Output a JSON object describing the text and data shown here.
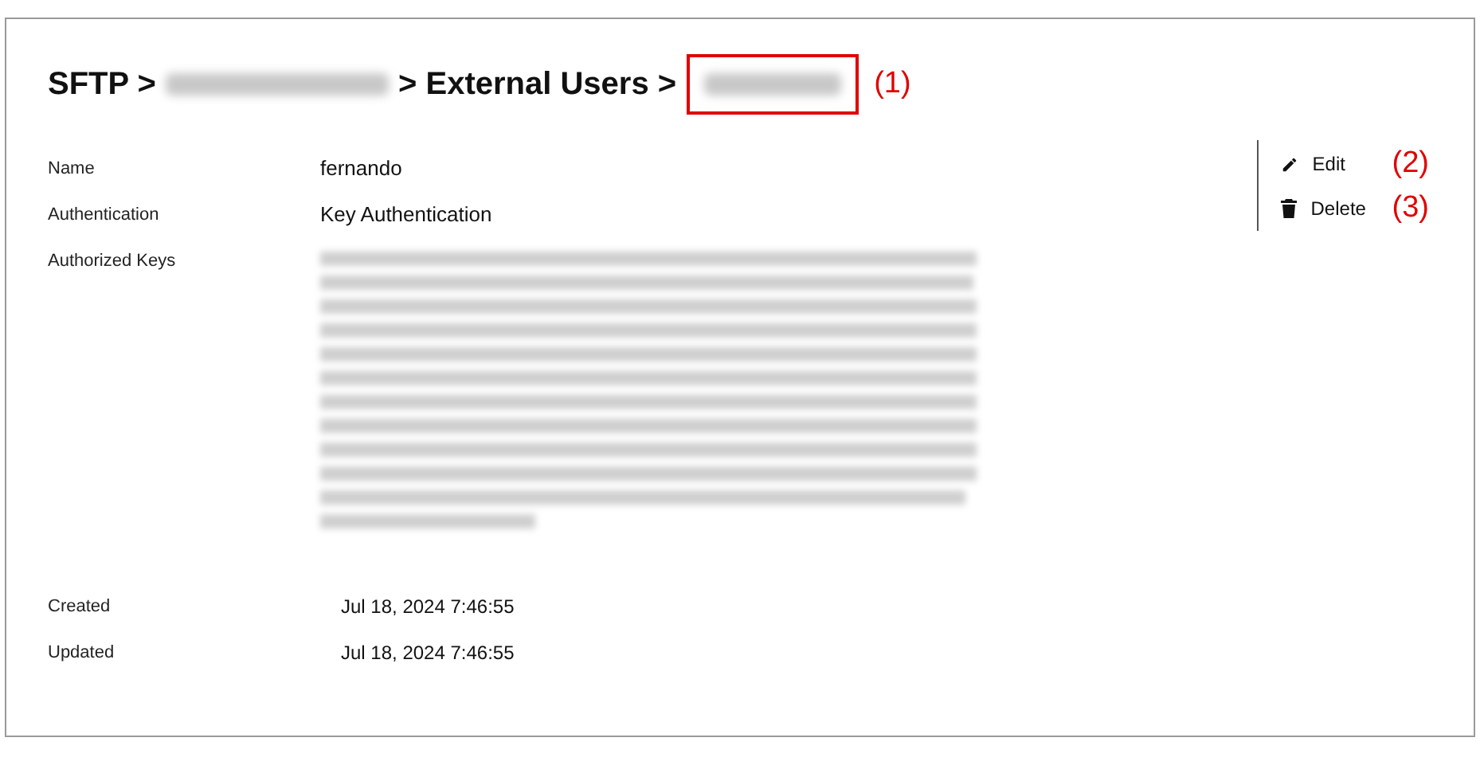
{
  "breadcrumb": [
    {
      "kind": "text",
      "text": "SFTP >"
    },
    {
      "kind": "redacted"
    },
    {
      "kind": "text",
      "text": "> External Users >"
    },
    {
      "kind": "redacted-highlighted",
      "note": "(1)"
    }
  ],
  "fields": [
    {
      "label": "Name",
      "value": "fernando"
    },
    {
      "label": "Authentication",
      "value": "Key Authentication"
    },
    {
      "label": "Authorized Keys",
      "kind": "redacted"
    }
  ],
  "timestamps": [
    {
      "label": "Created",
      "value": "Jul 18, 2024 7:46:55"
    },
    {
      "label": "Updated",
      "value": "Jul 18, 2024 7:46:55"
    }
  ],
  "actions": [
    {
      "kind": "edit",
      "label": "Edit",
      "note": "(2)"
    },
    {
      "kind": "delete",
      "label": "Delete",
      "note": "(3)"
    }
  ]
}
